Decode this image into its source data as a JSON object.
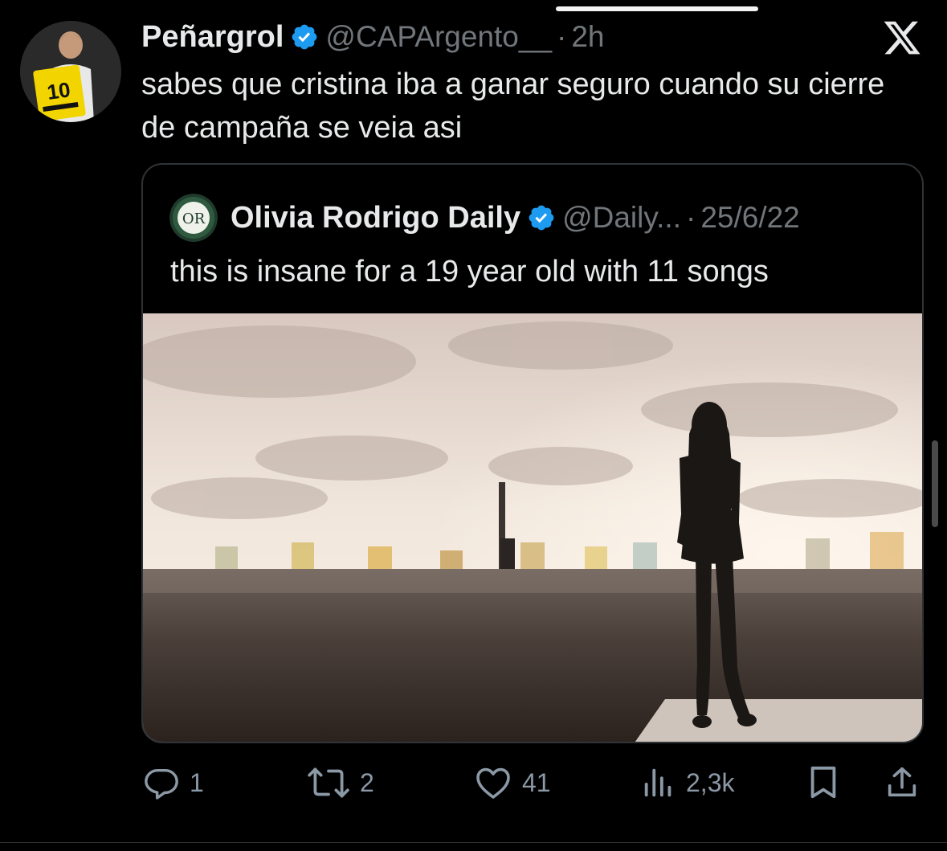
{
  "tweet": {
    "display_name": "Peñargrol",
    "handle": "@CAPArgento__",
    "separator": "·",
    "time": "2h",
    "text": "sabes que cristina iba a ganar seguro cuando su cierre de campaña se veia asi",
    "verified": true,
    "avatar_icon": "profile-photo"
  },
  "quote": {
    "display_name": "Olivia Rodrigo Daily",
    "handle": "@Daily...",
    "separator": "·",
    "time": "25/6/22",
    "text": "this is insane for a 19 year old with 11 songs",
    "verified": true,
    "media_icon": "concert-photo"
  },
  "actions": {
    "replies": "1",
    "reposts": "2",
    "likes": "41",
    "views": "2,3k"
  },
  "colors": {
    "background": "#000000",
    "text": "#e7e9ea",
    "muted": "#71767b",
    "verified": "#1d9bf0",
    "border": "#2f3336",
    "action_icon": "#8b98a5"
  }
}
